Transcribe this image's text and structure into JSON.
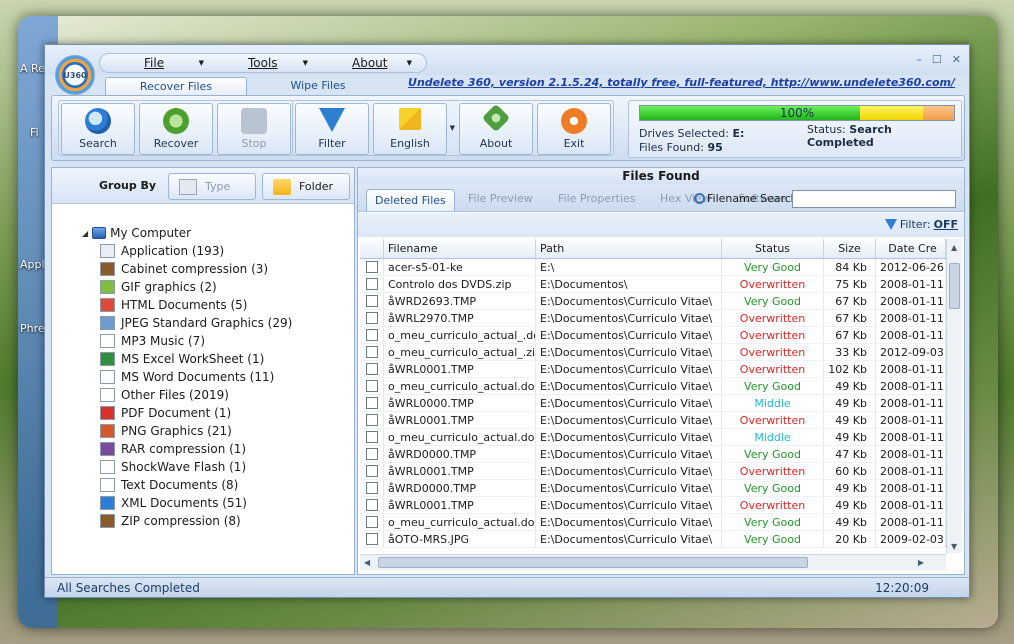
{
  "desktop": {
    "labels": [
      "A Re",
      "Fi",
      "Appl",
      "Phre"
    ]
  },
  "app": {
    "logo": "U360",
    "version_link": "Undelete 360, version 2.1.5.24, totally free, full-featured, http://www.undelete360.com/"
  },
  "menu": [
    {
      "label": "File"
    },
    {
      "label": "Tools"
    },
    {
      "label": "About"
    }
  ],
  "window_controls": {
    "min": "–",
    "max": "☐",
    "close": "✕"
  },
  "top_tabs": [
    {
      "label": "Recover Files",
      "active": true
    },
    {
      "label": "Wipe Files",
      "active": false
    }
  ],
  "ribbon": {
    "search": "Search",
    "recover": "Recover",
    "stop": "Stop",
    "filter": "Filter",
    "english": "English",
    "about": "About",
    "exit": "Exit"
  },
  "status_panel": {
    "progress": 100,
    "progress_text": "100%",
    "drives_label": "Drives Selected:",
    "drives_value": "E:",
    "files_label": "Files Found:",
    "files_value": "95",
    "status_label": "Status:",
    "status_value": "Search Completed"
  },
  "left": {
    "group_by": "Group By",
    "type_btn": "Type",
    "folder_btn": "Folder",
    "root": "My Computer",
    "items": [
      {
        "label": "Application (193)",
        "color": "#e9eef5"
      },
      {
        "label": "Cabinet compression (3)",
        "color": "#8b5a2b"
      },
      {
        "label": "GIF graphics (2)",
        "color": "#7fbf3f"
      },
      {
        "label": "HTML Documents (5)",
        "color": "#e0483a"
      },
      {
        "label": "JPEG Standard Graphics (29)",
        "color": "#6b9ccf"
      },
      {
        "label": "MP3 Music (7)",
        "color": "#ffffff"
      },
      {
        "label": "MS Excel WorkSheet (1)",
        "color": "#2f8f3c"
      },
      {
        "label": "MS Word Documents (11)",
        "color": "#ffffff"
      },
      {
        "label": "Other Files (2019)",
        "color": "#ffffff"
      },
      {
        "label": "PDF Document (1)",
        "color": "#d8302a"
      },
      {
        "label": "PNG Graphics (21)",
        "color": "#d6582b"
      },
      {
        "label": "RAR compression (1)",
        "color": "#7a4a9c"
      },
      {
        "label": "ShockWave Flash (1)",
        "color": "#ffffff"
      },
      {
        "label": "Text Documents (8)",
        "color": "#ffffff"
      },
      {
        "label": "XML Documents (51)",
        "color": "#2b7fd6"
      },
      {
        "label": "ZIP compression (8)",
        "color": "#8b5a2b"
      }
    ]
  },
  "right": {
    "title": "Files Found",
    "tabs": [
      {
        "label": "Deleted Files",
        "active": true
      },
      {
        "label": "File Preview",
        "active": false
      },
      {
        "label": "File Properties",
        "active": false
      },
      {
        "label": "Hex View",
        "active": false
      },
      {
        "label": "Software L",
        "active": false
      }
    ],
    "filename_search": "Filename Search",
    "filename_value": "",
    "filter_label": "Filter:",
    "filter_value": "OFF",
    "columns": [
      "Filename",
      "Path",
      "Status",
      "Size",
      "Date Cre"
    ],
    "status_colors": {
      "Very Good": "#22962a",
      "Overwritten": "#e02424",
      "Middle": "#1fb8d8"
    },
    "rows": [
      {
        "filename": "acer-s5-01-ke",
        "path": "E:\\",
        "status": "Very Good",
        "size": "84 Kb",
        "date": "2012-06-26"
      },
      {
        "filename": "Controlo dos DVDS.zip",
        "path": "E:\\Documentos\\",
        "status": "Overwritten",
        "size": "75 Kb",
        "date": "2008-01-11"
      },
      {
        "filename": "åWRD2693.TMP",
        "path": "E:\\Documentos\\Curriculo Vitae\\",
        "status": "Very Good",
        "size": "67 Kb",
        "date": "2008-01-11"
      },
      {
        "filename": "åWRL2970.TMP",
        "path": "E:\\Documentos\\Curriculo Vitae\\",
        "status": "Overwritten",
        "size": "67 Kb",
        "date": "2008-01-11"
      },
      {
        "filename": "o_meu_curriculo_actual_.doc",
        "path": "E:\\Documentos\\Curriculo Vitae\\",
        "status": "Overwritten",
        "size": "67 Kb",
        "date": "2008-01-11"
      },
      {
        "filename": "o_meu_curriculo_actual_.zip",
        "path": "E:\\Documentos\\Curriculo Vitae\\",
        "status": "Overwritten",
        "size": "33 Kb",
        "date": "2012-09-03"
      },
      {
        "filename": "åWRL0001.TMP",
        "path": "E:\\Documentos\\Curriculo Vitae\\",
        "status": "Overwritten",
        "size": "102 Kb",
        "date": "2008-01-11"
      },
      {
        "filename": "o_meu_curriculo_actual.doc",
        "path": "E:\\Documentos\\Curriculo Vitae\\",
        "status": "Very Good",
        "size": "49 Kb",
        "date": "2008-01-11"
      },
      {
        "filename": "åWRL0000.TMP",
        "path": "E:\\Documentos\\Curriculo Vitae\\",
        "status": "Middle",
        "size": "49 Kb",
        "date": "2008-01-11"
      },
      {
        "filename": "åWRL0001.TMP",
        "path": "E:\\Documentos\\Curriculo Vitae\\",
        "status": "Overwritten",
        "size": "49 Kb",
        "date": "2008-01-11"
      },
      {
        "filename": "o_meu_curriculo_actual.doc",
        "path": "E:\\Documentos\\Curriculo Vitae\\",
        "status": "Middle",
        "size": "49 Kb",
        "date": "2008-01-11"
      },
      {
        "filename": "åWRD0000.TMP",
        "path": "E:\\Documentos\\Curriculo Vitae\\",
        "status": "Very Good",
        "size": "47 Kb",
        "date": "2008-01-11"
      },
      {
        "filename": "åWRL0001.TMP",
        "path": "E:\\Documentos\\Curriculo Vitae\\",
        "status": "Overwritten",
        "size": "60 Kb",
        "date": "2008-01-11"
      },
      {
        "filename": "åWRD0000.TMP",
        "path": "E:\\Documentos\\Curriculo Vitae\\",
        "status": "Very Good",
        "size": "49 Kb",
        "date": "2008-01-11"
      },
      {
        "filename": "åWRL0001.TMP",
        "path": "E:\\Documentos\\Curriculo Vitae\\",
        "status": "Overwritten",
        "size": "49 Kb",
        "date": "2008-01-11"
      },
      {
        "filename": "o_meu_curriculo_actual.doc",
        "path": "E:\\Documentos\\Curriculo Vitae\\",
        "status": "Very Good",
        "size": "49 Kb",
        "date": "2008-01-11"
      },
      {
        "filename": "åOTO-MRS.JPG",
        "path": "E:\\Documentos\\Curriculo Vitae\\",
        "status": "Very Good",
        "size": "20 Kb",
        "date": "2009-02-03"
      }
    ]
  },
  "statusbar": {
    "text": "All Searches Completed",
    "time": "12:20:09"
  }
}
